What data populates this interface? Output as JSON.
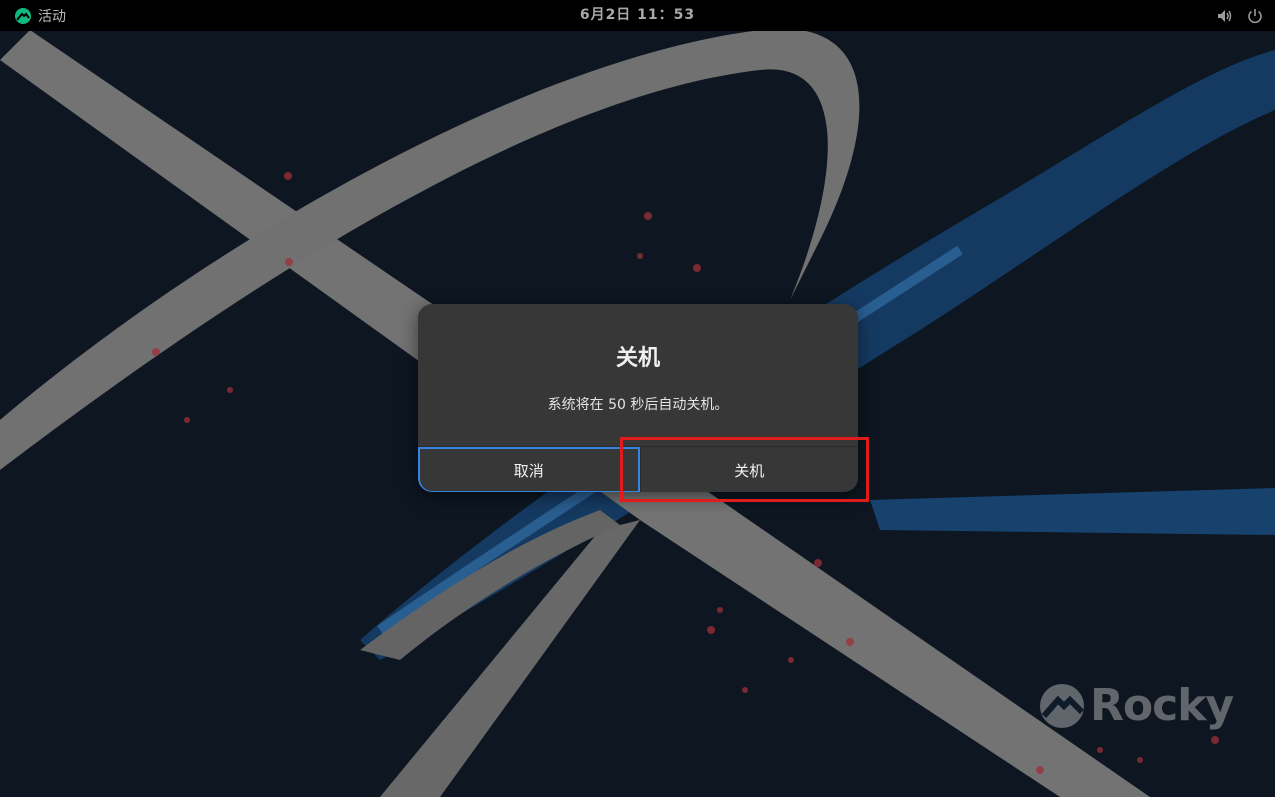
{
  "topbar": {
    "activities_label": "活动",
    "datetime": "6月2日  11：53",
    "tray_icons": [
      "volume-icon",
      "power-icon"
    ]
  },
  "dialog": {
    "title": "关机",
    "message": "系统将在 50 秒后自动关机。",
    "cancel_label": "取消",
    "poweroff_label": "关机"
  },
  "wallpaper": {
    "logo_text": "Rocky"
  },
  "colors": {
    "focus_ring": "#3584e4",
    "highlight_box": "#e01b1b",
    "dialog_bg": "#373737",
    "topbar_bg": "#000000"
  }
}
